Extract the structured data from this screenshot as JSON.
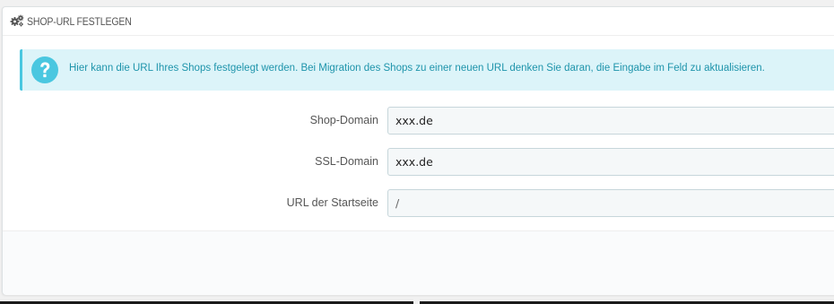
{
  "panel": {
    "heading": {
      "icon": "gears-icon",
      "title": "SHOP-URL FESTLEGEN"
    },
    "alert": {
      "icon": "question-circle-icon",
      "text": "Hier kann die URL Ihres Shops festgelegt werden. Bei Migration des Shops zu einer neuen URL denken Sie daran, die Eingabe im Feld zu aktualisieren."
    },
    "fields": {
      "shop_domain": {
        "label": "Shop-Domain",
        "value": "xxx.de"
      },
      "ssl_domain": {
        "label": "SSL-Domain",
        "value": "xxx.de"
      },
      "base_uri": {
        "label": "URL der Startseite",
        "value": "/"
      }
    }
  },
  "colors": {
    "alert_background": "#dcf4f9",
    "alert_border": "#4ac7e0",
    "alert_text": "#1e94ab",
    "input_background": "#f5f8f9",
    "input_border": "#c7d6db"
  }
}
